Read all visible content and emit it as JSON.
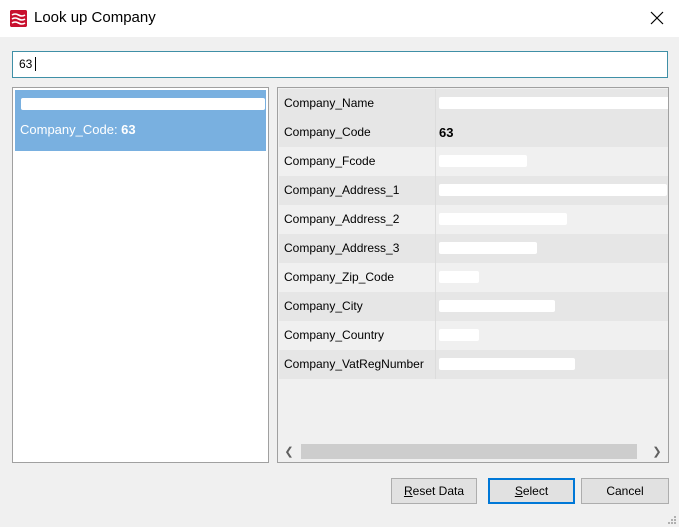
{
  "window": {
    "title": "Look up Company",
    "icon": "company-lookup-icon",
    "accent_color": "#c8102e"
  },
  "search": {
    "value": "63"
  },
  "results": [
    {
      "selected": true,
      "code_label": "Company_Code: ",
      "code_value": "63"
    }
  ],
  "details": {
    "rows": [
      {
        "name": "Company_Name",
        "value": "",
        "redacted": true
      },
      {
        "name": "Company_Code",
        "value": "63",
        "redacted": false
      },
      {
        "name": "Company_Fcode",
        "value": "",
        "redacted": true
      },
      {
        "name": "Company_Address_1",
        "value": "",
        "redacted": true
      },
      {
        "name": "Company_Address_2",
        "value": "",
        "redacted": true
      },
      {
        "name": "Company_Address_3",
        "value": "",
        "redacted": true
      },
      {
        "name": "Company_Zip_Code",
        "value": "",
        "redacted": true
      },
      {
        "name": "Company_City",
        "value": "",
        "redacted": true
      },
      {
        "name": "Company_Country",
        "value": "",
        "redacted": true
      },
      {
        "name": "Company_VatRegNumber",
        "value": "",
        "redacted": true
      }
    ]
  },
  "buttons": {
    "reset": {
      "mnemonic": "R",
      "rest": "eset Data"
    },
    "select": {
      "mnemonic": "S",
      "rest": "elect"
    },
    "cancel": {
      "label": "Cancel"
    }
  },
  "colors": {
    "selection": "#79b0e0",
    "focus_border": "#0078d7"
  }
}
